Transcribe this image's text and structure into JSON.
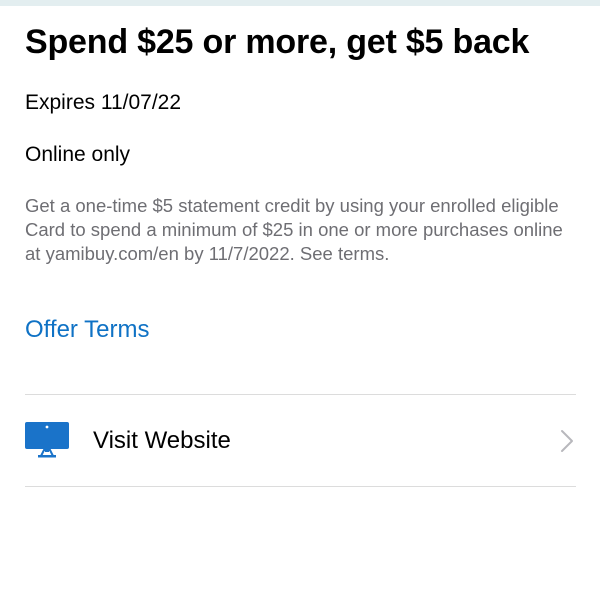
{
  "offer": {
    "title": "Spend $25 or more, get $5 back",
    "expires": "Expires 11/07/22",
    "channel": "Online only",
    "description": "Get a one-time $5 statement credit by using your enrolled eligible Card to spend a minimum of $25 in one or more purchases online at yamibuy.com/en by 11/7/2022.  See terms.",
    "terms_link": "Offer Terms"
  },
  "actions": {
    "visit_website": {
      "label": "Visit Website",
      "icon": "monitor-icon",
      "chevron": "chevron-right-icon"
    }
  },
  "colors": {
    "link": "#0f72c5",
    "icon": "#1a73c9",
    "secondary_text": "#6e6e73",
    "divider": "#dcdcdc",
    "chevron": "#b8b8bd"
  }
}
